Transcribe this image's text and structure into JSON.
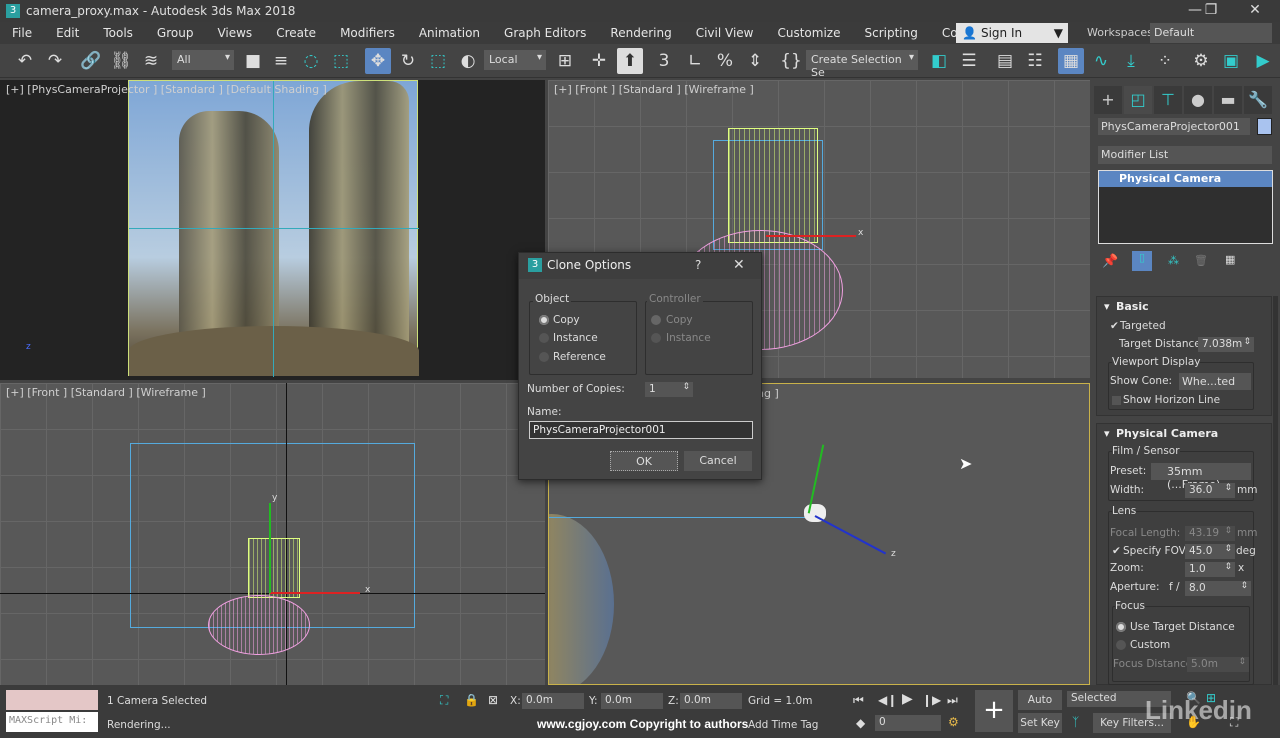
{
  "window": {
    "title": "camera_proxy.max - Autodesk 3ds Max 2018",
    "logo": "3",
    "minimize": "—",
    "restore": "❐",
    "close": "✕"
  },
  "menu": [
    "File",
    "Edit",
    "Tools",
    "Group",
    "Views",
    "Create",
    "Modifiers",
    "Animation",
    "Graph Editors",
    "Rendering",
    "Civil View",
    "Customize",
    "Scripting",
    "Content"
  ],
  "menu_overflow": "»",
  "signin": {
    "label": "Sign In",
    "icon": "user-icon"
  },
  "workspaces": {
    "label": "Workspaces:",
    "value": "Default"
  },
  "toolbar": {
    "selection_filter": "All",
    "reference_coord": "Local",
    "named_selection": "Create Selection Se",
    "snap_angle": "3",
    "snap_percent": "%"
  },
  "viewports": {
    "top_left": {
      "label": "[+] [PhysCameraProjector ] [Standard ] [Default Shading ]"
    },
    "top_right": {
      "label": "[+] [Front ] [Standard ] [Wireframe ]"
    },
    "bottom_left": {
      "label": "[+] [Front ] [Standard ] [Wireframe ]"
    },
    "bottom_right": {
      "label": "ng ]"
    }
  },
  "axis": {
    "x": "x",
    "y": "y",
    "z": "z"
  },
  "dialog": {
    "title": "Clone Options",
    "help": "?",
    "close": "✕",
    "icon": "3",
    "object": {
      "label": "Object",
      "options": [
        "Copy",
        "Instance",
        "Reference"
      ],
      "selected": "Copy"
    },
    "controller": {
      "label": "Controller",
      "options": [
        "Copy",
        "Instance"
      ],
      "selected": "Copy",
      "disabled": true
    },
    "copies_label": "Number of Copies:",
    "copies": "1",
    "name_label": "Name:",
    "name": "PhysCameraProjector001",
    "ok": "OK",
    "cancel": "Cancel"
  },
  "panel": {
    "object_name": "PhysCameraProjector001",
    "object_color": "#a9c3ef",
    "modifier_list": "Modifier List",
    "stack": [
      "Physical Camera"
    ],
    "basic": {
      "title": "Basic",
      "targeted": "Targeted",
      "targeted_checked": true,
      "target_distance_label": "Target Distance:",
      "target_distance": "7.038m",
      "viewport_display": "Viewport Display",
      "show_cone_label": "Show Cone:",
      "show_cone": "Whe...ted",
      "show_horizon": "Show Horizon Line",
      "show_horizon_checked": false
    },
    "physical": {
      "title": "Physical Camera",
      "film": "Film / Sensor",
      "preset_label": "Preset:",
      "preset": "35mm (...Frame)",
      "width_label": "Width:",
      "width": "36.0",
      "width_unit": "mm",
      "lens": "Lens",
      "focal_label": "Focal Length:",
      "focal": "43.19",
      "focal_unit": "mm",
      "fov_label": "Specify FOV:",
      "fov": "45.0",
      "fov_unit": "deg",
      "fov_checked": true,
      "zoom_label": "Zoom:",
      "zoom": "1.0",
      "zoom_unit": "x",
      "aperture_label": "Aperture:",
      "aperture_prefix": "f /",
      "aperture": "8.0",
      "focus": "Focus",
      "focus_options": [
        "Use Target Distance",
        "Custom"
      ],
      "focus_selected": "Use Target Distance",
      "focus_distance_label": "Focus Distance:",
      "focus_distance": "5.0m"
    }
  },
  "status": {
    "selection": "1 Camera Selected",
    "prompt": "Rendering...",
    "maxscript": "MAXScript Mi:",
    "x_label": "X:",
    "x": "0.0m",
    "y_label": "Y:",
    "y": "0.0m",
    "z_label": "Z:",
    "z": "0.0m",
    "grid": "Grid = 1.0m",
    "add_time_tag": "Add Time Tag",
    "watermark": "www.cgjoy.com Copyright to authors",
    "frame": "0",
    "auto_key": "Auto Key",
    "set_key": "Set Key",
    "key_mode": "Selected",
    "key_filters": "Key Filters...",
    "brand": "Linkedin"
  }
}
